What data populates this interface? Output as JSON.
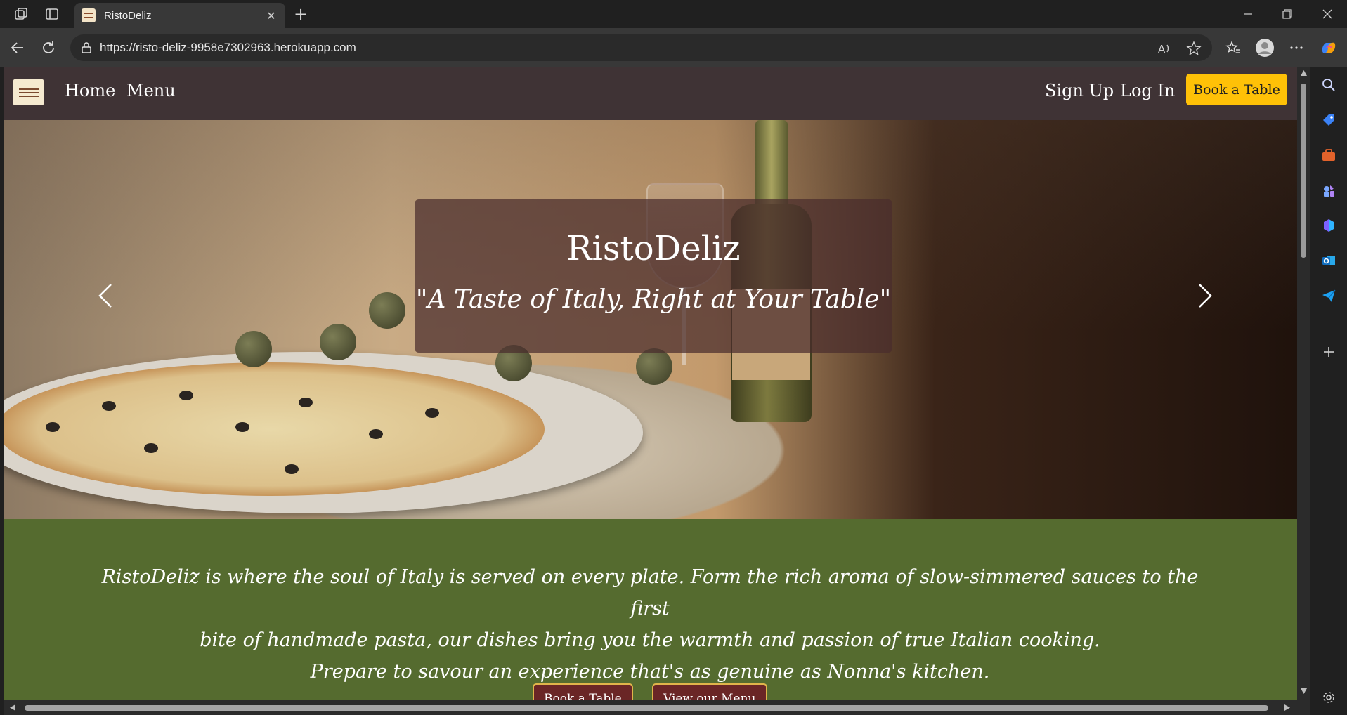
{
  "browser": {
    "tab_title": "RistoDeliz",
    "url": "https://risto-deliz-9958e7302963.herokuapp.com"
  },
  "site": {
    "nav": {
      "home": "Home",
      "menu": "Menu",
      "sign_up": "Sign Up",
      "log_in": "Log In",
      "book_button": "Book a Table"
    },
    "hero": {
      "title": "RistoDeliz",
      "subtitle": "\"A Taste of Italy, Right at Your Table\""
    },
    "intro": {
      "line1": "RistoDeliz is where the soul of Italy is served on every plate. Form the rich aroma of slow-simmered sauces to the first",
      "line2": "bite of handmade pasta, our dishes bring you the warmth and passion of true Italian cooking.",
      "line3": "Prepare to savour an experience that's as genuine as Nonna's kitchen."
    },
    "cta": {
      "book": "Book a Table",
      "menu": "View our Menu"
    }
  },
  "colors": {
    "nav_bg": "#3f3335",
    "accent": "#ffc107",
    "intro_bg": "#556b2f",
    "cta_bg": "#6a2626"
  }
}
